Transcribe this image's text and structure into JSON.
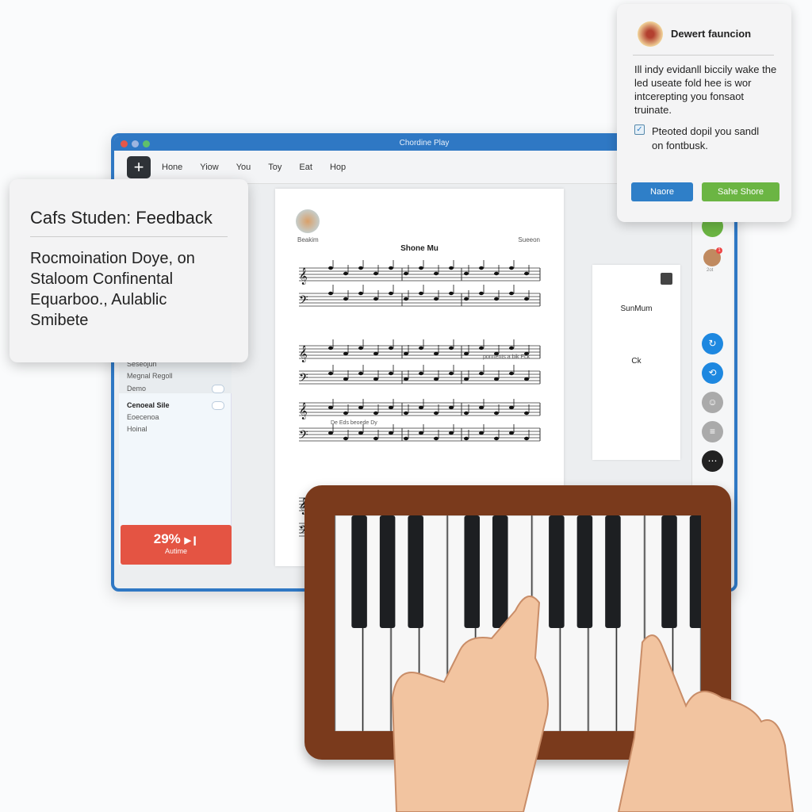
{
  "window": {
    "title": "Chordine Play",
    "menu": [
      "Hone",
      "Yiow",
      "You",
      "Toy",
      "Eat",
      "Hop"
    ],
    "add_icon": "plus-icon"
  },
  "sidebar": {
    "items": [
      {
        "label": "Seseojun"
      },
      {
        "label": "Megnal Regoll"
      },
      {
        "label": "Demo"
      },
      {
        "label": "Cenoeal Sile"
      },
      {
        "label": "Eoecenoa"
      },
      {
        "label": "Hoinal"
      }
    ],
    "progress": {
      "value": "29%",
      "label": "Autime",
      "percent": 29
    }
  },
  "sheet": {
    "avatar_caption": "Beakim",
    "right_caption": "Sueeon",
    "title": "Shone Mu",
    "annotation1": "ponnents a bik Eck",
    "annotation2": "De Eds beoede Dy"
  },
  "right_card": {
    "title": "SunMum",
    "value": "Ck"
  },
  "rail": {
    "avatar_caption": "2ot",
    "badge": "1"
  },
  "feedback": {
    "title": "Cafs Studen: Feedback",
    "body": "Rocmoination Doye, on Staloom Confinental Equarboo., Aulablic Smibete"
  },
  "popup": {
    "title": "Dewert fauncion",
    "body": "Ill indy evidanll biccily wake the led useate fold hee is wor intcerepting you fonsaot truinate.",
    "checkbox_label": "Pteoted dopil you sandl on fontbusk.",
    "checked": true,
    "btn1": "Naore",
    "btn2": "Sahe Shore",
    "colors": {
      "blue": "#2f7fc8",
      "green": "#6bb543"
    }
  }
}
